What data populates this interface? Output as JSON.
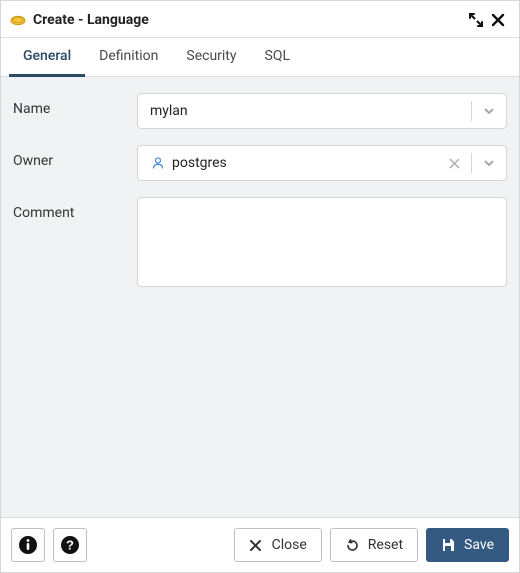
{
  "header": {
    "title": "Create - Language"
  },
  "tabs": {
    "general": "General",
    "definition": "Definition",
    "security": "Security",
    "sql": "SQL",
    "active": "general"
  },
  "form": {
    "name_label": "Name",
    "name_value": "mylan",
    "owner_label": "Owner",
    "owner_value": "postgres",
    "comment_label": "Comment",
    "comment_value": ""
  },
  "footer": {
    "close_label": "Close",
    "reset_label": "Reset",
    "save_label": "Save"
  }
}
